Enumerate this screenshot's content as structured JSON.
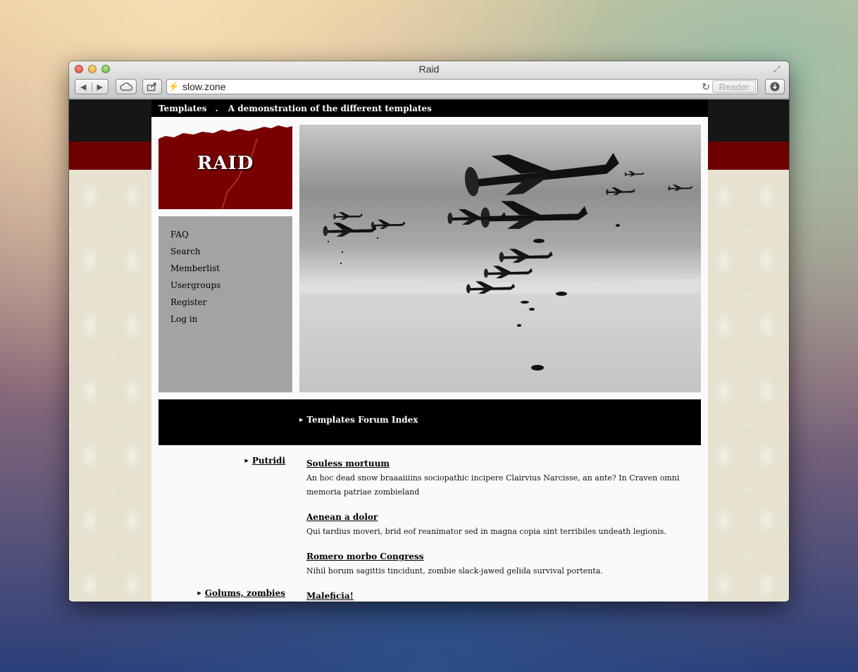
{
  "window": {
    "title": "Raid"
  },
  "toolbar": {
    "back": "◀",
    "forward": "▶",
    "url": "slow.zone",
    "reader": "Reader"
  },
  "topnav": {
    "home": "Templates",
    "sep": ".",
    "tagline": "A demonstration of the different templates"
  },
  "logo": {
    "text": "RAID"
  },
  "menu": {
    "items": [
      {
        "label": "FAQ"
      },
      {
        "label": "Search"
      },
      {
        "label": "Memberlist"
      },
      {
        "label": "Usergroups"
      },
      {
        "label": "Register"
      },
      {
        "label": "Log in"
      }
    ]
  },
  "breadcrumb": {
    "label": "Templates Forum Index"
  },
  "forums": [
    {
      "category": "Putridi",
      "topics": [
        {
          "title": "Souless mortuum",
          "desc": "An hoc dead snow braaaiiiins sociopathic incipere Clairvius Narcisse, an ante? In Craven omni memoria patriae zombieland"
        },
        {
          "title": "Aenean a dolor",
          "desc": "Qui tardius moveri, brid eof reanimator sed in magna copia sint terribiles undeath legionis."
        },
        {
          "title": "Romero morbo Congress",
          "desc": "Nihil horum sagittis tincidunt, zombie slack-jawed gelida survival portenta."
        }
      ]
    },
    {
      "category": "Golums, zombies",
      "topics": [
        {
          "title": "Maleficia!",
          "desc": ""
        }
      ]
    }
  ]
}
